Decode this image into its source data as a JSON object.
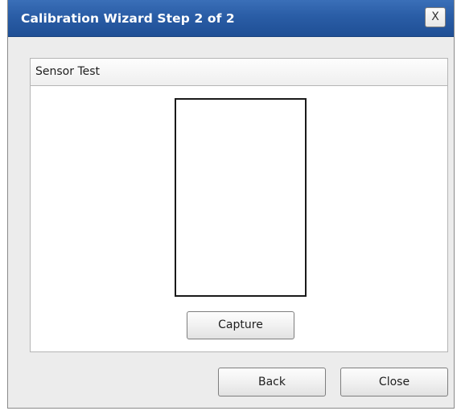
{
  "window": {
    "title": "Calibration Wizard Step 2 of 2",
    "close_label": "X"
  },
  "sensor_test": {
    "header": "Sensor Test",
    "capture_label": "Capture"
  },
  "footer": {
    "back_label": "Back",
    "close_label": "Close"
  },
  "colors": {
    "titlebar": "#2a5da6",
    "dialog_background": "#ececec",
    "panel_background": "#ffffff",
    "sensor_border": "#1a1a1a"
  }
}
